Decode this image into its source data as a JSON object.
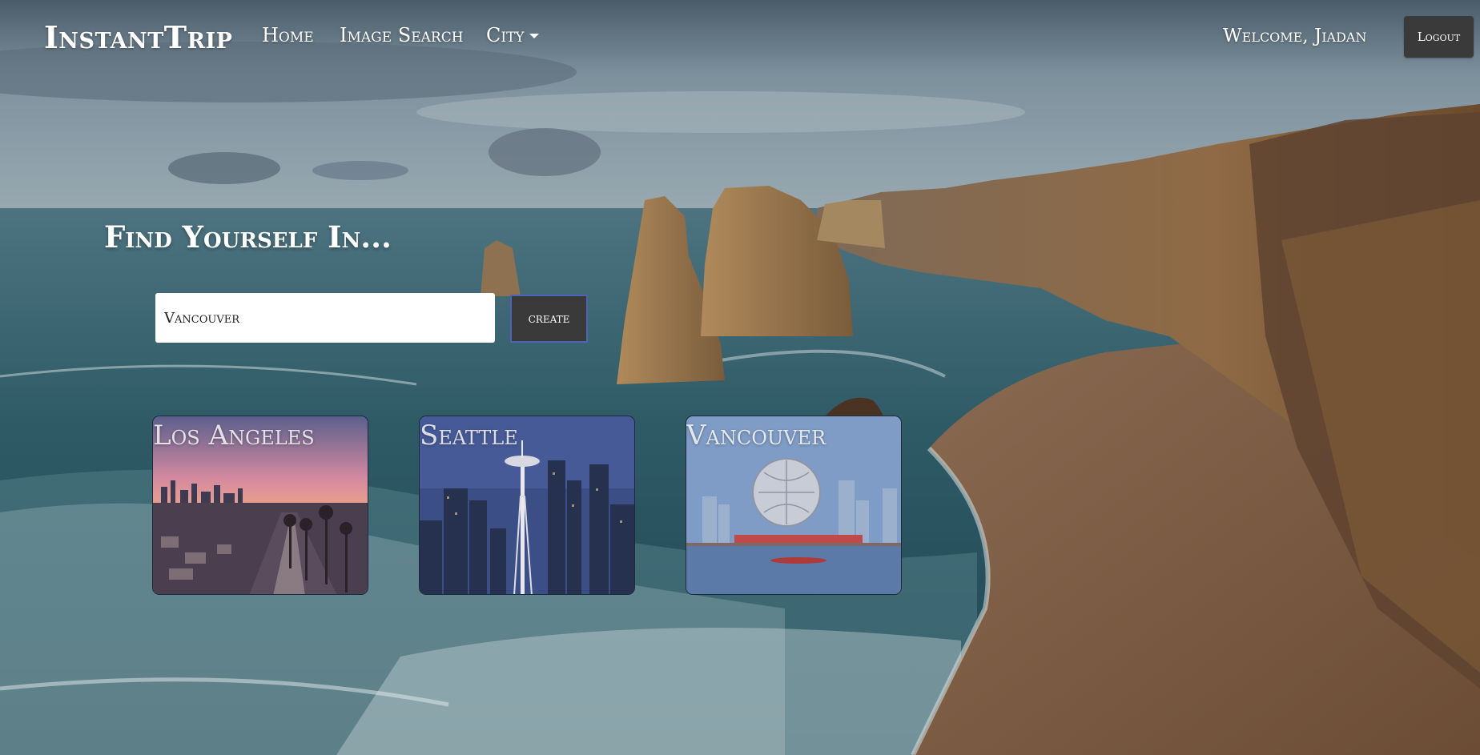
{
  "nav": {
    "brand": "InstantTrip",
    "links": [
      {
        "label": "Home"
      },
      {
        "label": "Image Search"
      },
      {
        "label": "City"
      }
    ],
    "welcome": "Welcome, Jiadan",
    "logout_label": "Logout"
  },
  "hero": {
    "headline": "Find Yourself In...",
    "input_value": "Vancouver",
    "create_label": "create"
  },
  "cities": [
    {
      "name": "Los Angeles"
    },
    {
      "name": "Seattle"
    },
    {
      "name": "Vancouver"
    }
  ],
  "colors": {
    "button_bg": "#3b3a3b",
    "create_border": "#4d63b8",
    "text": "#ffffff"
  }
}
